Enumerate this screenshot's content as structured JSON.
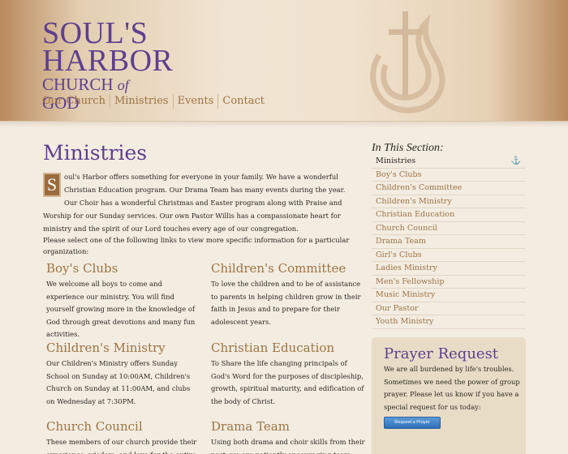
{
  "logo": {
    "line1": "SOUL'S",
    "line2": "HARBOR",
    "line3_a": "CHURCH ",
    "line3_of": "of",
    "line3_b": " GOD"
  },
  "nav": [
    "Our Church",
    "Ministries",
    "Events",
    "Contact"
  ],
  "page_title": "Ministries",
  "intro": {
    "dropcap": "S",
    "text": "oul's Harbor offers something for everyone in your family. We have a wonderful Christian Education program. Our Drama Team has many events during the year. Our Choir has a wonderful Christmas and Easter program along with Praise and Worship for our Sunday services. Our own Pastor Willis has a compassionate heart for ministry and the spirit of our Lord touches every age of our congregation."
  },
  "select_line": "Please select one of the following links to view more specific information for a particular organization:",
  "ministries": [
    {
      "title": "Boy's Clubs",
      "text": "We welcome all boys to come and experience our ministry. You will find yourself growing more in the knowledge of God through great devotions and many fun activities."
    },
    {
      "title": "Children's Committee",
      "text": "To love the children and to be of assistance to parents in helping children grow in their faith in Jesus and to prepare for their adolescent years."
    },
    {
      "title": "Children's Ministry",
      "text": "Our Children's Ministry offers Sunday School on Sunday at 10:00AM, Children's Church on Sunday at 11:00AM, and clubs on Wednesday at 7:30PM."
    },
    {
      "title": "Christian Education",
      "text": "To Share the life changing principals of God's Word for the purposes of discipleship, growth, spiritual maturity, and edification of the body of Christ."
    },
    {
      "title": "Church Council",
      "text": "These members of our church provide their experience, wisdom, and love for the entire"
    },
    {
      "title": "Drama Team",
      "text": "Using both drama and choir skills from their past, we are patiently encouraging team"
    }
  ],
  "sidebar": {
    "title": "In This Section:",
    "items": [
      "Ministries",
      "Boy's Clubs",
      "Children's Committee",
      "Children's Ministry",
      "Christian Education",
      "Church Council",
      "Drama Team",
      "Girl's Clubs",
      "Ladies Ministry",
      "Men's Fellowship",
      "Music Ministry",
      "Our Pastor",
      "Youth Ministry"
    ],
    "anchor_icon": "⚓"
  },
  "prayer": {
    "title": "Prayer Request",
    "text": "We are all burdened by life's troubles. Sometimes we need the power of group prayer. Please let us know if you have a special request for us today:",
    "button": "Request a Prayer"
  },
  "colors": {
    "purple": "#5e3f8f",
    "gold": "#9c7444",
    "background": "#f3ece1"
  }
}
